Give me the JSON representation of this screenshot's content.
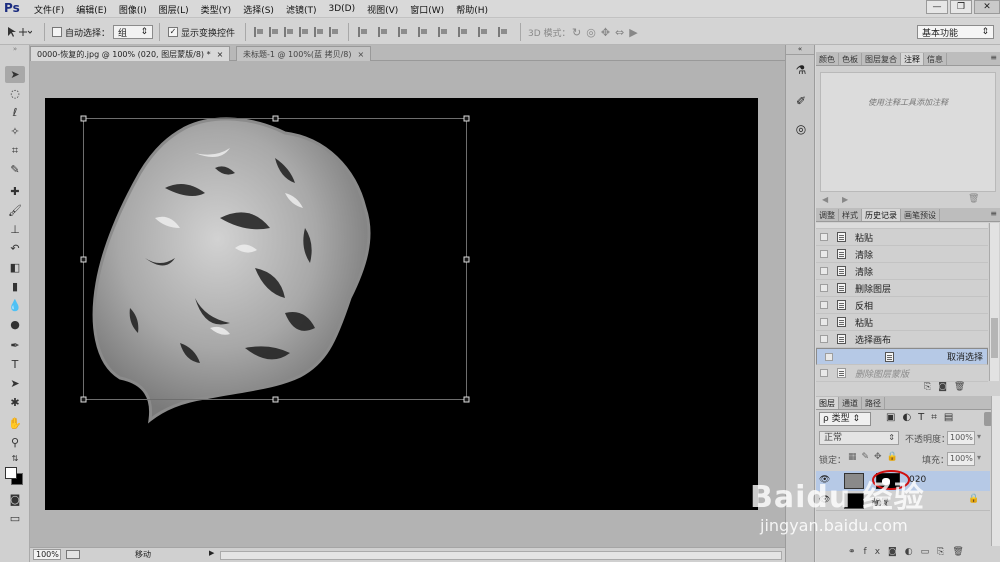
{
  "app": {
    "logo": "Ps",
    "menu": [
      "文件(F)",
      "编辑(E)",
      "图像(I)",
      "图层(L)",
      "类型(Y)",
      "选择(S)",
      "滤镜(T)",
      "3D(D)",
      "视图(V)",
      "窗口(W)",
      "帮助(H)"
    ],
    "window_buttons": [
      "—",
      "❐",
      "✕"
    ]
  },
  "options": {
    "auto_select_label": "自动选择：",
    "auto_select_value": "组",
    "show_transform_label": "显示变换控件",
    "mode_3d_label": "3D 模式：",
    "workspace": "基本功能"
  },
  "tabs": [
    {
      "label": "0000-恢复的.jpg @ 100% (020, 图层蒙版/8) *",
      "close": "×"
    },
    {
      "label": "未标题-1 @ 100%(蓝 拷贝/8)",
      "close": "×"
    }
  ],
  "status": {
    "zoom": "100%",
    "tool": "移动",
    "arrow": "▶"
  },
  "panels": {
    "top_tabs": [
      "颜色",
      "色板",
      "图层复合",
      "注释",
      "信息"
    ],
    "notes_placeholder": "使用注释工具添加注释",
    "mid_tabs": [
      "调整",
      "样式",
      "历史记录",
      "画笔预设"
    ],
    "history": [
      "粘贴",
      "清除",
      "清除",
      "删除图层",
      "反相",
      "粘贴",
      "选择画布",
      "取消选择",
      "删除图层蒙版"
    ],
    "layers_tabs": [
      "图层",
      "通道",
      "路径"
    ],
    "filter_kind": "ρ 类型",
    "blend_mode": "正常",
    "opacity_label": "不透明度：",
    "opacity_value": "100%",
    "lock_label": "锁定：",
    "fill_label": "填充：",
    "fill_value": "100%",
    "layer_name": "020",
    "background_label": "背景"
  },
  "watermark": {
    "brand": "Baidu 经验",
    "url": "jingyan.baidu.com"
  },
  "colors": {
    "canvas": "#000000",
    "selection_highlight": "#b6c9e6",
    "ps_blue": "#1b2c80",
    "annotation_circle": "#d01010"
  }
}
